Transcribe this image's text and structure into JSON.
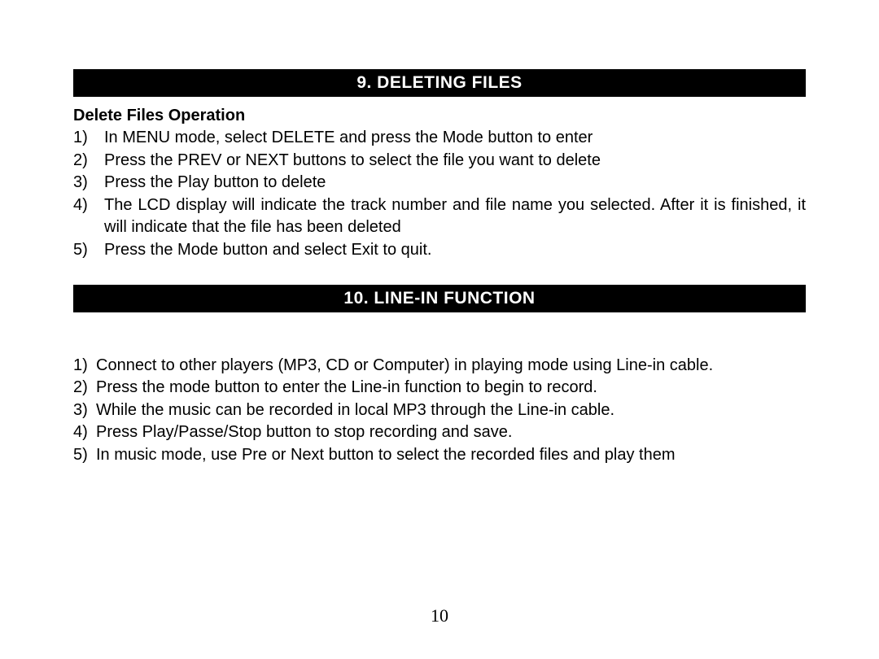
{
  "section1": {
    "header": "9.  DELETING FILES",
    "subheading": "Delete Files Operation",
    "items": [
      {
        "num": "1)",
        "text": "In MENU mode, select DELETE and press the Mode button to enter"
      },
      {
        "num": "2)",
        "text": "Press the PREV or NEXT buttons to select the file you want to delete"
      },
      {
        "num": "3)",
        "text": "Press the Play button to delete"
      },
      {
        "num": "4)",
        "text": "The LCD display will indicate the track number and file name you selected. After it is finished, it will indicate that the file has been deleted"
      },
      {
        "num": "5)",
        "text": "Press the Mode button and select Exit to quit."
      }
    ]
  },
  "section2": {
    "header": "10.  LINE-IN FUNCTION",
    "items": [
      {
        "num": "1)",
        "text": "Connect to other players (MP3, CD or Computer) in playing mode using Line-in cable."
      },
      {
        "num": "2)",
        "text": "Press the mode button to enter the Line-in function to begin to record."
      },
      {
        "num": "3)",
        "text": "While the music can be recorded in local MP3 through the Line-in cable."
      },
      {
        "num": "4)",
        "text": "Press Play/Passe/Stop button to stop recording and save."
      },
      {
        "num": "5)",
        "text": "In music mode, use Pre or Next button to select the recorded files and play them"
      }
    ]
  },
  "pageNumber": "10"
}
